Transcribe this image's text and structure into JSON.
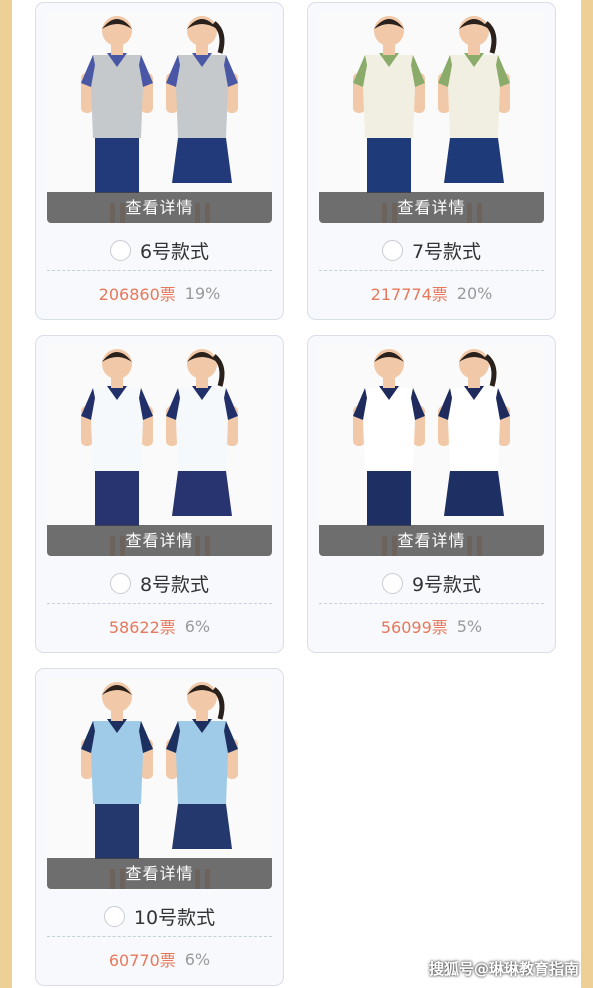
{
  "detail_label": "查看详情",
  "options": [
    {
      "label": "6号款式",
      "votes": "206860票",
      "percent": "19%",
      "shirt": "#c5c9cc",
      "trim": "#4a57a5",
      "bottom": "#233a7a",
      "girl_bottom": "#233a7a"
    },
    {
      "label": "7号款式",
      "votes": "217774票",
      "percent": "20%",
      "shirt": "#f1efe2",
      "trim": "#8aab6a",
      "bottom": "#1f3a78",
      "girl_bottom": "#1f3a78"
    },
    {
      "label": "8号款式",
      "votes": "58622票",
      "percent": "6%",
      "shirt": "#f5f9fb",
      "trim": "#22306a",
      "bottom": "#27346f",
      "girl_bottom": "#27346f"
    },
    {
      "label": "9号款式",
      "votes": "56099票",
      "percent": "5%",
      "shirt": "#ffffff",
      "trim": "#1e2b5c",
      "bottom": "#1e2f63",
      "girl_bottom": "#1e2f63"
    },
    {
      "label": "10号款式",
      "votes": "60770票",
      "percent": "6%",
      "shirt": "#9fcbe9",
      "trim": "#1d2f5e",
      "bottom": "#25386e",
      "girl_bottom": "#25386e"
    }
  ],
  "watermark": "搜狐号@琳琳教育指南"
}
